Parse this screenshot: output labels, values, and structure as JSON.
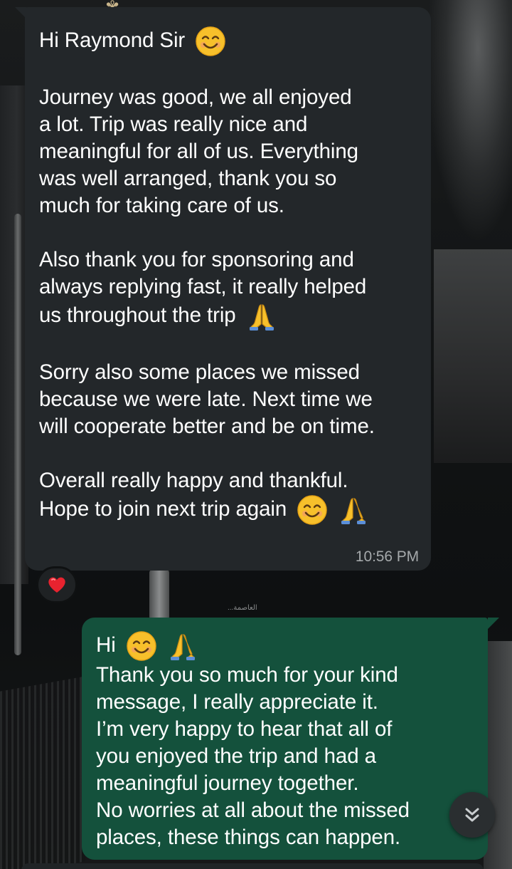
{
  "incoming": {
    "greeting": "Hi Raymond Sir",
    "p1": [
      "Journey was good, we all enjoyed",
      "a lot. Trip was really nice and",
      "meaningful for all of us. Everything",
      "was well arranged, thank you so",
      "much for taking care of us."
    ],
    "p2": [
      "Also thank you for sponsoring and",
      "always replying fast, it really helped",
      "us throughout the trip"
    ],
    "p3": [
      "Sorry also some places we missed",
      "because we were late. Next time we",
      "will cooperate better and be on time."
    ],
    "p4": [
      "Overall really happy and thankful.",
      "Hope to join next trip again"
    ],
    "time": "10:56 PM",
    "reaction": "heart"
  },
  "outgoing": {
    "lines": [
      "Hi",
      "Thank you so much for your kind",
      "message, I really appreciate it.",
      "I’m very happy to hear that all of",
      "you enjoyed the trip and had a",
      "meaningful journey together.",
      "No worries at all about the missed",
      "places, these things can happen."
    ]
  },
  "wallpaper": {
    "label": "...العاصمة"
  },
  "colors": {
    "incoming_bubble": "#23272a",
    "outgoing_bubble": "#14513c",
    "timestamp": "#a5a9ab"
  },
  "icons": {
    "smile": "smiling-face-icon",
    "pray": "folded-hands-icon",
    "heart": "red-heart-icon",
    "scroll": "double-chevron-down-icon"
  }
}
